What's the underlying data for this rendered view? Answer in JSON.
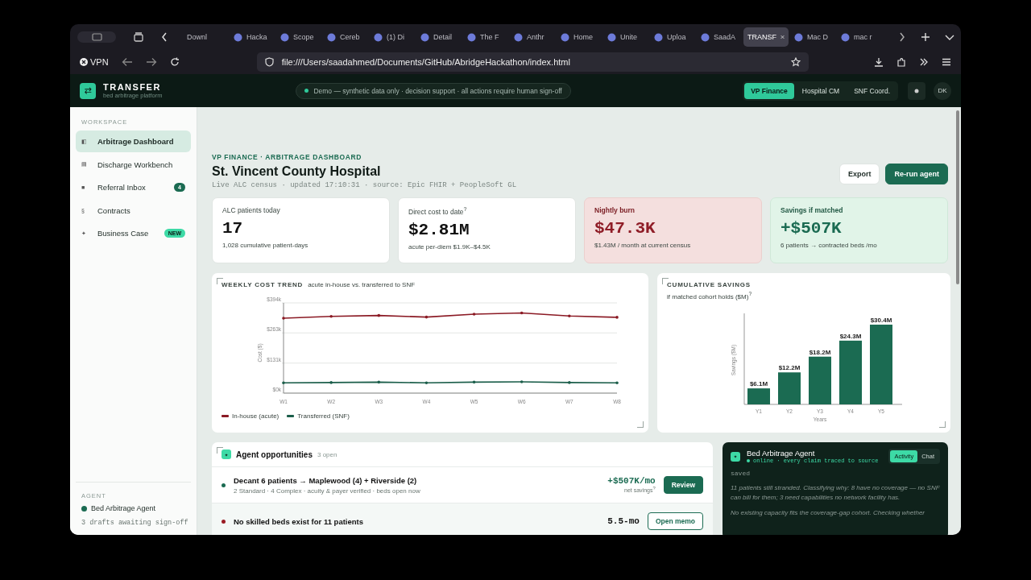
{
  "browser": {
    "tabs": [
      {
        "label": "Downl",
        "selected": false,
        "has_icon": false
      },
      {
        "label": "Hacka",
        "selected": false,
        "has_icon": true
      },
      {
        "label": "Scope",
        "selected": false,
        "has_icon": true
      },
      {
        "label": "Cereb",
        "selected": false,
        "has_icon": true
      },
      {
        "label": "(1) Di",
        "selected": false,
        "has_icon": true
      },
      {
        "label": "Detail",
        "selected": false,
        "has_icon": true
      },
      {
        "label": "The F",
        "selected": false,
        "has_icon": true
      },
      {
        "label": "Anthr",
        "selected": false,
        "has_icon": true
      },
      {
        "label": "Home",
        "selected": false,
        "has_icon": true
      },
      {
        "label": "Unite",
        "selected": false,
        "has_icon": true
      },
      {
        "label": "Uploa",
        "selected": false,
        "has_icon": true
      },
      {
        "label": "SaadA",
        "selected": false,
        "has_icon": true
      },
      {
        "label": "TRANSF",
        "selected": true,
        "has_icon": false
      },
      {
        "label": "Mac D",
        "selected": false,
        "has_icon": true
      },
      {
        "label": "mac r",
        "selected": false,
        "has_icon": true
      }
    ],
    "vpn_label": "VPN",
    "url": "file:///Users/saadahmed/Documents/GitHub/AbridgeHackathon/index.html"
  },
  "app_header": {
    "logo_glyph": "⇄",
    "brand": "TRANSFER",
    "tagline": "bed arbitrage platform",
    "notice": "Demo — synthetic data only · decision support · all actions require human sign-off",
    "roles": [
      {
        "label": "VP Finance",
        "selected": true
      },
      {
        "label": "Hospital CM",
        "selected": false
      },
      {
        "label": "SNF Coord.",
        "selected": false
      }
    ],
    "avatar": "DK"
  },
  "sidebar": {
    "section": "WORKSPACE",
    "items": [
      {
        "icon": "◧",
        "label": "Arbitrage Dashboard",
        "selected": true
      },
      {
        "icon": "▤",
        "label": "Discharge Workbench",
        "selected": false
      },
      {
        "icon": "■",
        "label": "Referral Inbox",
        "selected": false,
        "badge": "4",
        "kind": "count"
      },
      {
        "icon": "§",
        "label": "Contracts",
        "selected": false
      },
      {
        "icon": "✦",
        "label": "Business Case",
        "selected": false,
        "badge": "NEW",
        "kind": "new"
      }
    ],
    "agent_section": "AGENT",
    "agent_name": "Bed Arbitrage Agent",
    "agent_note": "3 drafts awaiting sign-off"
  },
  "page": {
    "eyebrow": "VP FINANCE · ARBITRAGE DASHBOARD",
    "title": "St. Vincent County Hospital",
    "subtitle": "Live ALC census · updated 17:10:31 · source: Epic FHIR + PeopleSoft GL",
    "actions": [
      {
        "label": "Export",
        "kind": "secondary"
      },
      {
        "label": "Re-run agent",
        "kind": "primary"
      }
    ]
  },
  "kpis": [
    {
      "label": "ALC patients today",
      "value": "17",
      "note": "1,028 cumulative patient-days",
      "kind": "neutral"
    },
    {
      "label": "Direct cost to date$^{?}$",
      "value": "$2.81M",
      "note": "acute per-diem $1.9K–$4.5K",
      "kind": "neutral"
    },
    {
      "label": "Nightly burn",
      "value": "$47.3K",
      "note": "$1.43M / month at current census",
      "kind": "danger"
    },
    {
      "label": "Savings if matched",
      "value": "+$507K",
      "note": "6 patients → contracted beds /mo",
      "kind": "success"
    }
  ],
  "weekly_chart": {
    "title": "WEEKLY COST TREND",
    "subtitle": "acute in-house vs. transferred to SNF",
    "chart_data": {
      "type": "line",
      "ylabel": "Cost ($)",
      "categories": [
        "W1",
        "W2",
        "W3",
        "W4",
        "W5",
        "W6",
        "W7",
        "W8"
      ],
      "series": [
        {
          "name": "In-house (acute)",
          "color": "#8b1a24",
          "values": [
            327,
            335,
            339,
            332,
            345,
            350,
            337,
            331
          ]
        },
        {
          "name": "Transferred (SNF)",
          "color": "#1b5e4a",
          "values": [
            45,
            46,
            48,
            45,
            48,
            49,
            46,
            45
          ]
        }
      ],
      "ylim": [
        0,
        394
      ],
      "yticks": [
        {
          "value": 0,
          "label": "$0k"
        },
        {
          "value": 131,
          "label": "$131k"
        },
        {
          "value": 263,
          "label": "$263k"
        },
        {
          "value": 394,
          "label": "$394k"
        }
      ]
    }
  },
  "savings_chart": {
    "title": "CUMULATIVE SAVINGS",
    "subtitle": "if matched cohort holds ($M)$^{?}$",
    "chart_data": {
      "type": "bar",
      "xlabel": "Years",
      "ylabel": "Savings ($M)",
      "categories": [
        "Y1",
        "Y2",
        "Y3",
        "Y4",
        "Y5"
      ],
      "series": [
        {
          "color": "#1b6b52",
          "values": [
            6.1,
            12.2,
            18.2,
            24.3,
            30.4
          ]
        }
      ],
      "data_labels": true,
      "value_labels": [
        "$6.1M",
        "$12.2M",
        "$18.2M",
        "$24.3M",
        "$30.4M"
      ]
    }
  },
  "opportunities": {
    "glyph": "✦",
    "title": "Agent opportunities",
    "count": "3 open",
    "rows": [
      {
        "title": "Decant 6 patients → Maplewood (4) + Riverside (2)",
        "detail": "2 Standard · 4 Complex · acuity & payer verified · beds open now",
        "value": "+$507K/mo",
        "value_note": "net savings$^{?}$",
        "action": "Review",
        "kind": "primary",
        "color": "#1b6b52"
      },
      {
        "title": "No skilled beds exist for 11 patients",
        "value": "5.5-mo",
        "action": "Open memo",
        "kind": "secondary",
        "color": "#9b1c24"
      }
    ]
  },
  "agent_panel": {
    "glyph": "✦",
    "name": "Bed Arbitrage Agent",
    "status": "online · every claim traced to source",
    "tabs": [
      {
        "label": "Activity",
        "selected": true
      },
      {
        "label": "Chat",
        "selected": false
      }
    ],
    "log": [
      {
        "kind": "label",
        "text": "saved"
      },
      {
        "kind": "message",
        "text": "11 patients still stranded. Classifying why: 8 have no coverage — no SNF can bill for them; 3 need capabilities no network facility has."
      },
      {
        "kind": "message",
        "text": "No existing capacity fits the coverage-gap cohort. Checking whether"
      }
    ]
  }
}
